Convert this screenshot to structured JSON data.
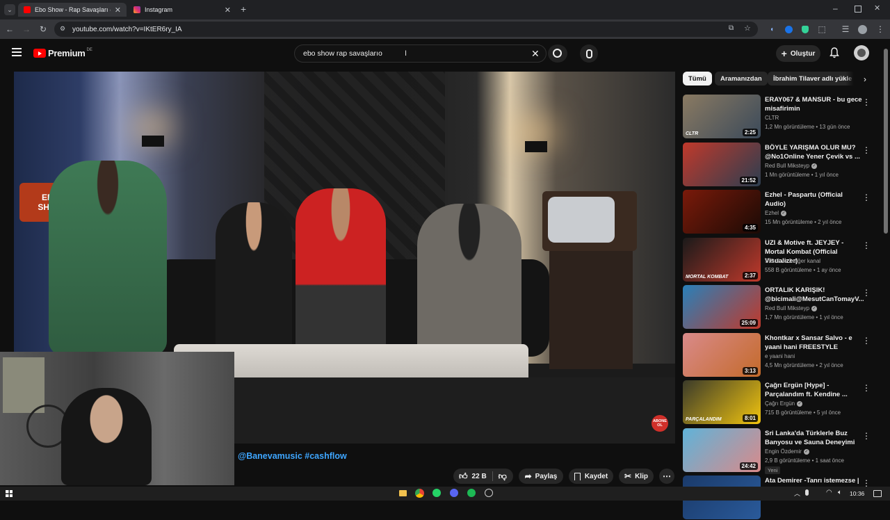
{
  "browser": {
    "tabs": [
      {
        "title": "Ebo Show - Rap Savaşları @san",
        "active": true,
        "favicon": "youtube-favicon",
        "color": "#ff0000"
      },
      {
        "title": "Instagram",
        "active": false,
        "favicon": "instagram-favicon",
        "color": "#e1306c"
      }
    ],
    "new_tab": "+",
    "url": "youtube.com/watch?v=IKtER6ry_IA"
  },
  "header": {
    "logo_text": "Premium",
    "logo_region": "DE",
    "search_value": "ebo show rap savaşlarıo",
    "create_label": "Oluştur"
  },
  "video": {
    "caption_text": "@Banevamusic #cashflow",
    "subscribe_badge": "ABONE OL",
    "show_logo": "EBO SHOW"
  },
  "actions": {
    "like_count": "22 B",
    "share_label": "Paylaş",
    "save_label": "Kaydet",
    "clip_label": "Klip"
  },
  "chips": [
    "Tümü",
    "Aramanızdan",
    "İbrahim Tilaver adlı yüklе"
  ],
  "recommendations": [
    {
      "title": "ERAY067 & MANSUR - bu gece misafirimin",
      "channel": "CLTR",
      "verified": false,
      "meta": "1,2 Mn görüntüleme • 13 gün önce",
      "duration": "2:25",
      "badge": "CLTR",
      "colors": [
        "#8a7a62",
        "#3b4a5a"
      ]
    },
    {
      "title": "BÖYLE YARIŞMA OLUR MU? @No1Online Yener Çevik vs ...",
      "channel": "Red Bull Mikstеyp",
      "verified": true,
      "meta": "1 Mn görüntüleme • 1 yıl önce",
      "duration": "21:52",
      "badge": "",
      "colors": [
        "#c0392b",
        "#2c3e50"
      ]
    },
    {
      "title": "Ezhel - Paspartu (Official Audio)",
      "channel": "Ezhel",
      "verified": true,
      "meta": "15 Mn görüntüleme • 2 yıl önce",
      "duration": "4:35",
      "badge": "",
      "colors": [
        "#7a1a0a",
        "#1a0a05"
      ]
    },
    {
      "title": "UZI & Motive ft. JEYJEY - Mortal Kombat (Official Visualizer)",
      "channel": "S.O.S ve 2 diğer kanal",
      "verified": false,
      "meta": "558 B görüntüleme • 1 ay önce",
      "duration": "2:37",
      "badge": "MORTAL KOMBAT",
      "colors": [
        "#1a1a1a",
        "#c0392b"
      ]
    },
    {
      "title": "ORTALIK KARIŞIK! @bicimali@MesutCanTomayV...",
      "channel": "Red Bull Mikstеyp",
      "verified": true,
      "meta": "1,7 Mn görüntüleme • 1 yıl önce",
      "duration": "25:09",
      "badge": "",
      "colors": [
        "#2980b9",
        "#c0392b"
      ]
    },
    {
      "title": "Khontkar x Sansar Salvo - e yaani hani FREESTYLE",
      "channel": "e yaani hani",
      "verified": false,
      "meta": "4,5 Mn görüntüleme • 2 yıl önce",
      "duration": "3:13",
      "badge": "",
      "colors": [
        "#d98a8a",
        "#c46a2a"
      ]
    },
    {
      "title": "Çağrı Ergün [Hype] - Parçalandım ft. Kendine ...",
      "channel": "Çağrı Ergün",
      "verified": true,
      "meta": "715 B görüntüleme • 5 yıl önce",
      "duration": "8:01",
      "badge": "PARÇALANDIM",
      "colors": [
        "#3a3a2a",
        "#f1c40f"
      ]
    },
    {
      "title": "Sri Lanka'da Türklerle Buz Banyosu ve Sauna Deneyimi",
      "channel": "Engin Özdemir",
      "verified": true,
      "meta": "2,9 B görüntüleme • 1 saat önce",
      "duration": "24:42",
      "badge": "",
      "new": "Yeni",
      "colors": [
        "#5fb3d9",
        "#d98a8a"
      ]
    },
    {
      "title": "Ata Demirer -Tanrı istemezse |",
      "channel": "",
      "verified": false,
      "meta": "",
      "duration": "",
      "badge": "",
      "colors": [
        "#1a3a6a",
        "#2a5a9a"
      ]
    }
  ],
  "taskbar": {
    "clock": "10:36"
  }
}
